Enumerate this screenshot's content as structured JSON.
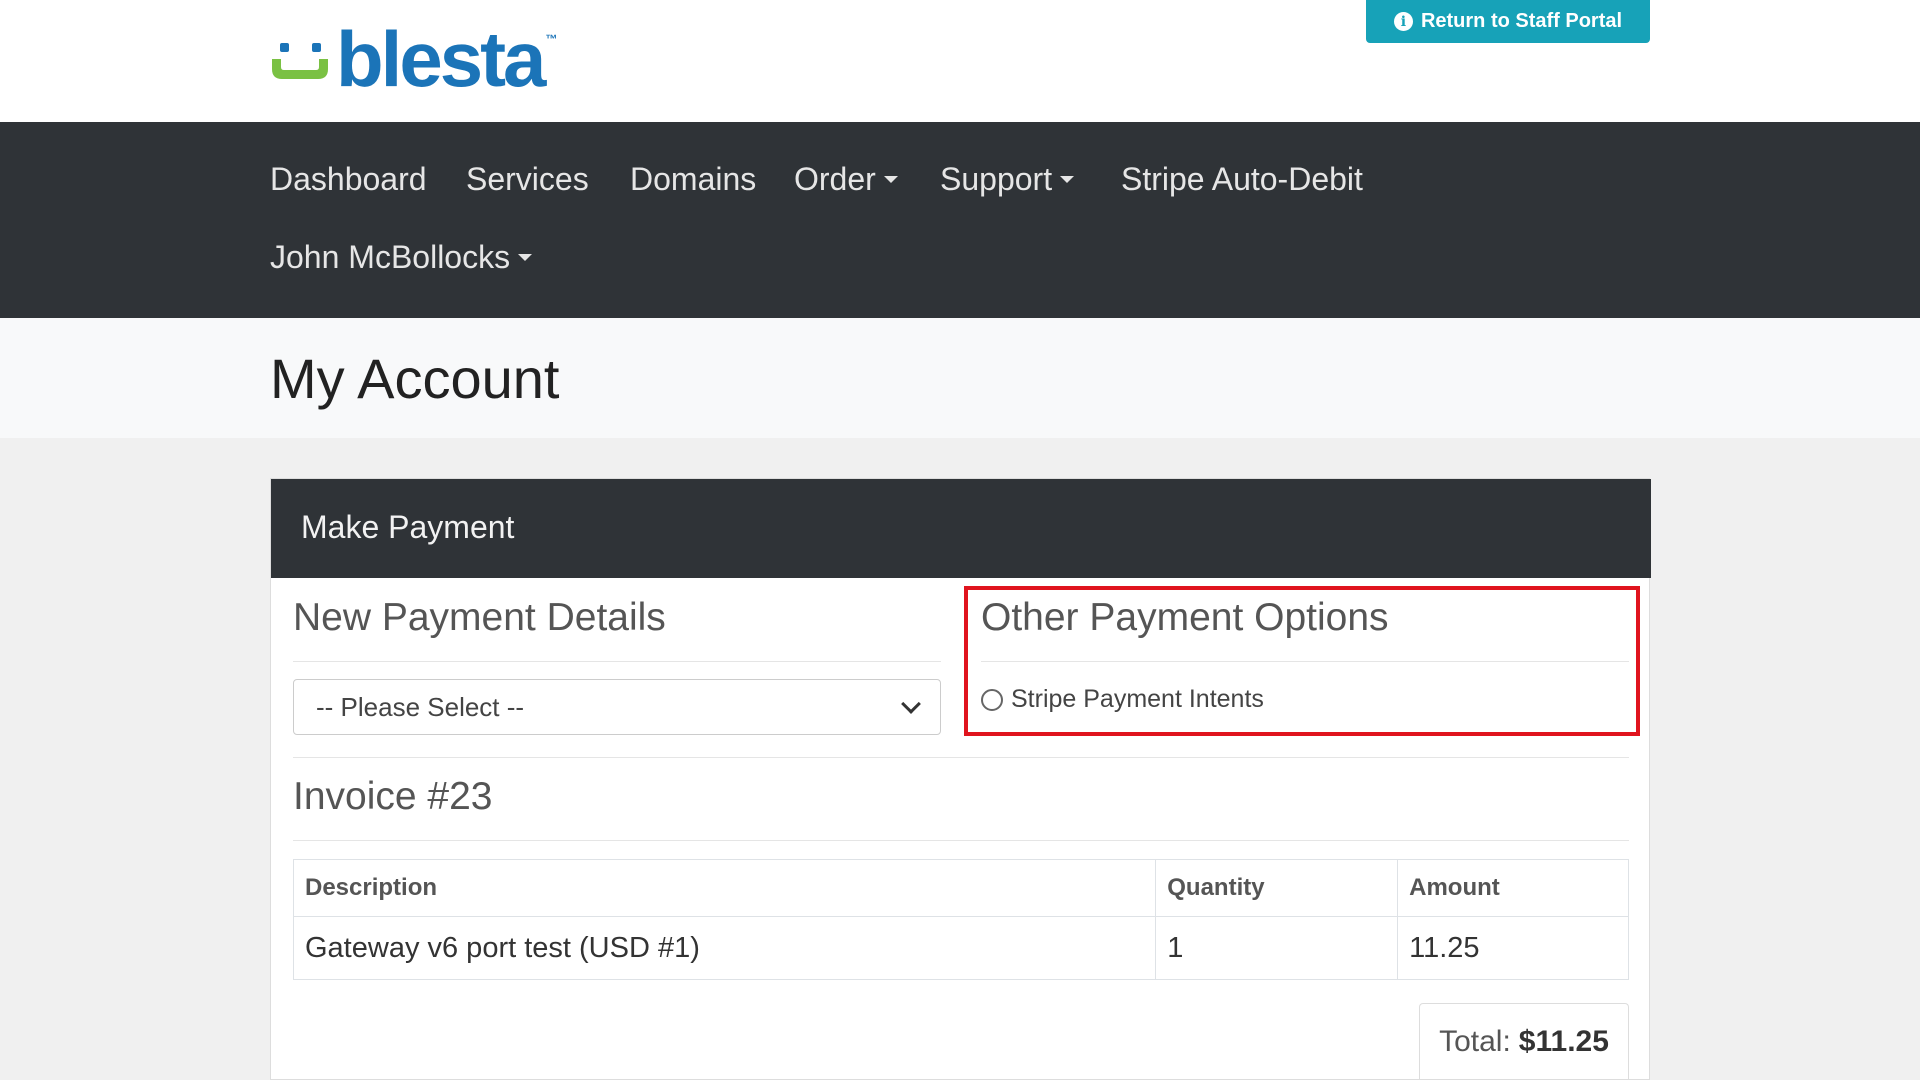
{
  "brand": {
    "logo_text": "blesta",
    "trademark": "™",
    "logo_icon": "smiley-logo-icon"
  },
  "header": {
    "staff_button_label": "Return to Staff Portal",
    "staff_button_icon": "info-icon"
  },
  "nav": {
    "items": [
      {
        "label": "Dashboard",
        "dropdown": false
      },
      {
        "label": "Services",
        "dropdown": false
      },
      {
        "label": "Domains",
        "dropdown": false
      },
      {
        "label": "Order",
        "dropdown": true
      },
      {
        "label": "Support",
        "dropdown": true
      },
      {
        "label": "Stripe Auto-Debit",
        "dropdown": false
      },
      {
        "label": "John McBollocks",
        "dropdown": true
      }
    ]
  },
  "page": {
    "title": "My Account"
  },
  "payment": {
    "card_title": "Make Payment",
    "new_details_title": "New Payment Details",
    "select_value": "-- Please Select --",
    "other_options_title": "Other Payment Options",
    "option_label": "Stripe Payment Intents",
    "option_selected": false
  },
  "invoice": {
    "title": "Invoice #23",
    "columns": [
      "Description",
      "Quantity",
      "Amount"
    ],
    "rows": [
      {
        "description": "Gateway v6 port test (USD #1)",
        "quantity": "1",
        "amount": "11.25"
      }
    ],
    "total_label": "Total:",
    "total_value": "$11.25"
  },
  "colors": {
    "brand_blue": "#1b74b8",
    "brand_green": "#7ac143",
    "staff_button": "#17a2b8",
    "navbar": "#2f3337",
    "highlight": "#e0141e"
  }
}
